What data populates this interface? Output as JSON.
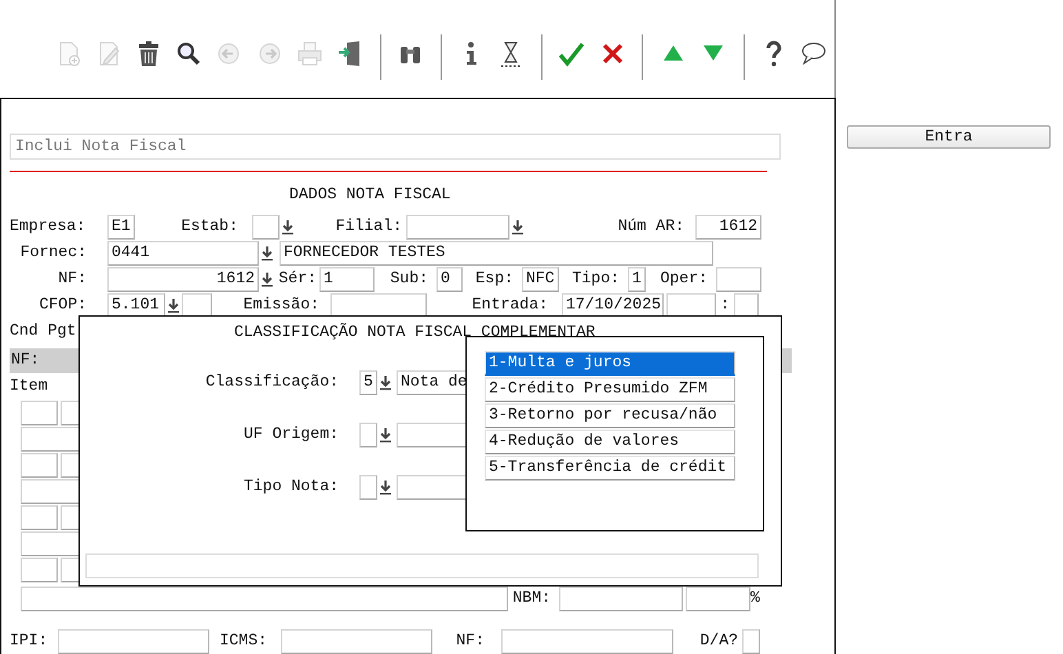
{
  "toolbar": [
    {
      "kind": "new",
      "disabled": true
    },
    {
      "kind": "edit",
      "disabled": true
    },
    {
      "kind": "delete",
      "disabled": false
    },
    {
      "kind": "search",
      "disabled": false
    },
    {
      "kind": "back",
      "disabled": true
    },
    {
      "kind": "forward",
      "disabled": true
    },
    {
      "kind": "print",
      "disabled": true
    },
    {
      "kind": "exit",
      "disabled": false
    },
    {
      "kind": "separator"
    },
    {
      "kind": "find",
      "disabled": false
    },
    {
      "kind": "separator"
    },
    {
      "kind": "info",
      "disabled": false
    },
    {
      "kind": "wait",
      "disabled": false
    },
    {
      "kind": "separator"
    },
    {
      "kind": "confirm",
      "disabled": false
    },
    {
      "kind": "cancel",
      "disabled": false
    },
    {
      "kind": "separator"
    },
    {
      "kind": "up",
      "disabled": false
    },
    {
      "kind": "down",
      "disabled": false
    },
    {
      "kind": "separator"
    },
    {
      "kind": "help",
      "disabled": false
    },
    {
      "kind": "comment",
      "disabled": false
    }
  ],
  "side_button": {
    "label": "Entra"
  },
  "form": {
    "header": "Inclui Nota Fiscal",
    "section_title": "DADOS NOTA FISCAL",
    "empresa": {
      "label": "Empresa:",
      "value": "E1"
    },
    "estab": {
      "label": "Estab:"
    },
    "filial": {
      "label": "Filial:"
    },
    "num_ar": {
      "label": "Núm AR:",
      "value": "1612"
    },
    "fornec": {
      "label": "Fornec:",
      "value": "0441",
      "name": "FORNECEDOR TESTES"
    },
    "nf": {
      "label": "NF:",
      "value": "1612"
    },
    "serie": {
      "label": "Sér:",
      "value": "1"
    },
    "sub": {
      "label": "Sub:",
      "value": "0"
    },
    "esp": {
      "label": "Esp:",
      "value": "NFC"
    },
    "tipo": {
      "label": "Tipo:",
      "value": "1"
    },
    "oper": {
      "label": "Oper:"
    },
    "cfop": {
      "label": "CFOP:",
      "value": "5.101"
    },
    "emissao": {
      "label": "Emissão:"
    },
    "entrada": {
      "label": "Entrada:",
      "value": "17/10/2025"
    },
    "column_label": ":",
    "cnd_pgt": "Cnd Pgt",
    "nf_bar": "NF:",
    "item_label": "Item",
    "nbm": {
      "label": "NBM:",
      "unit": "%"
    },
    "ipi": {
      "label": "IPI:"
    },
    "icms": {
      "label": "ICMS:"
    },
    "nf_total": {
      "label": "NF:"
    },
    "da": {
      "label": "D/A?"
    }
  },
  "dialog": {
    "title": "CLASSIFICAÇÃO NOTA FISCAL COMPLEMENTAR",
    "fields": [
      {
        "label": "Classificação:",
        "code": "5",
        "description": "Nota de"
      },
      {
        "label": "UF Origem:"
      },
      {
        "label": "Tipo Nota:"
      }
    ],
    "options": [
      {
        "text": "1-Multa e juros",
        "selected": true
      },
      {
        "text": "2-Crédito Presumido ZFM",
        "selected": false
      },
      {
        "text": "3-Retorno por recusa/não",
        "selected": false
      },
      {
        "text": "4-Redução de valores",
        "selected": false
      },
      {
        "text": "5-Transferência de crédit",
        "selected": false
      }
    ]
  }
}
